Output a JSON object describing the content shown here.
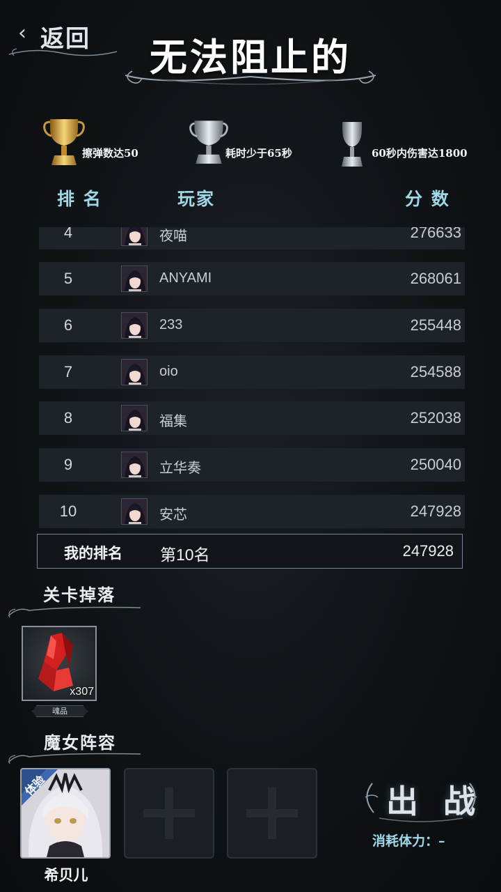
{
  "header": {
    "back_label": "返回",
    "title": "无法阻止的"
  },
  "trophies": [
    {
      "label": "擦弹数达50",
      "tier": "gold",
      "icon": "gold-trophy-icon"
    },
    {
      "label": "耗时少于65秒",
      "tier": "silver",
      "icon": "silver-trophy-icon"
    },
    {
      "label": "60秒内伤害达1800",
      "tier": "silver",
      "icon": "silver-trophy-icon"
    }
  ],
  "leaderboard": {
    "columns": {
      "rank": "排 名",
      "player": "玩家",
      "score": "分 数"
    },
    "rows": [
      {
        "rank": "4",
        "name": "夜喵",
        "score": "276633"
      },
      {
        "rank": "5",
        "name": "ANYAMI",
        "score": "268061"
      },
      {
        "rank": "6",
        "name": "233",
        "score": "255448"
      },
      {
        "rank": "7",
        "name": "oio",
        "score": "254588"
      },
      {
        "rank": "8",
        "name": "福集",
        "score": "252038"
      },
      {
        "rank": "9",
        "name": "立华奏",
        "score": "250040"
      },
      {
        "rank": "10",
        "name": "安芯",
        "score": "247928"
      }
    ],
    "my_rank": {
      "label": "我的排名",
      "position": "第10名",
      "score": "247928"
    }
  },
  "drops": {
    "title": "关卡掉落",
    "items": [
      {
        "name": "魂品",
        "quantity": "x307",
        "icon": "red-crystal-icon"
      }
    ]
  },
  "team": {
    "title": "魔女阵容",
    "members": [
      {
        "name": "希贝儿",
        "badge": "体验"
      }
    ],
    "empty_slots": 2
  },
  "battle": {
    "label": "出 战",
    "cost": "消耗体力：–"
  },
  "colors": {
    "accent": "#9fd8e8",
    "row_bg": "#1d2329",
    "background": "#101316"
  }
}
